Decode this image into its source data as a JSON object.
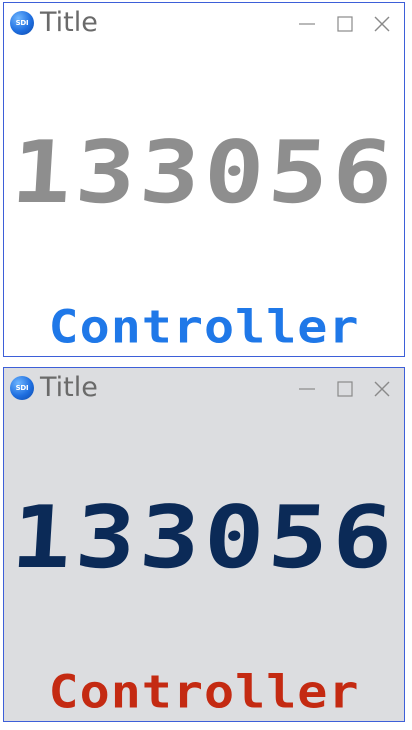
{
  "windows": [
    {
      "title": "Title",
      "app_icon_text": "SDI",
      "value": "133056",
      "label": "Controller",
      "colors": {
        "background": "#ffffff",
        "value": "#8e8e8e",
        "label": "#1f78e8"
      }
    },
    {
      "title": "Title",
      "app_icon_text": "SDI",
      "value": "133056",
      "label": "Controller",
      "colors": {
        "background": "#dcdde0",
        "value": "#0b2a57",
        "label": "#c42a12"
      }
    }
  ],
  "icons": {
    "app": "app-logo-icon",
    "minimize": "minimize-icon",
    "maximize": "maximize-icon",
    "close": "close-icon"
  },
  "accent": "#3d5fd8"
}
